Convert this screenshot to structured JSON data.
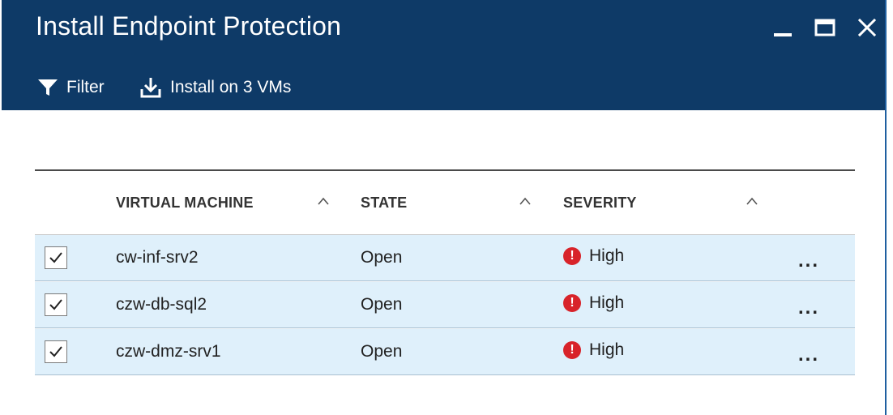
{
  "header": {
    "title": "Install Endpoint Protection",
    "background": "#0e3a67"
  },
  "toolbar": {
    "filter_label": "Filter",
    "install_label": "Install on 3 VMs"
  },
  "grid": {
    "columns": [
      "VIRTUAL MACHINE",
      "STATE",
      "SEVERITY"
    ],
    "rows": [
      {
        "vm": "cw-inf-srv2",
        "state": "Open",
        "severity": "High",
        "checked": true
      },
      {
        "vm": "czw-db-sql2",
        "state": "Open",
        "severity": "High",
        "checked": true
      },
      {
        "vm": "czw-dmz-srv1",
        "state": "Open",
        "severity": "High",
        "checked": true
      }
    ],
    "row_background": "#dff0fb",
    "severity_color": "#d8232a",
    "more_label": "..."
  }
}
